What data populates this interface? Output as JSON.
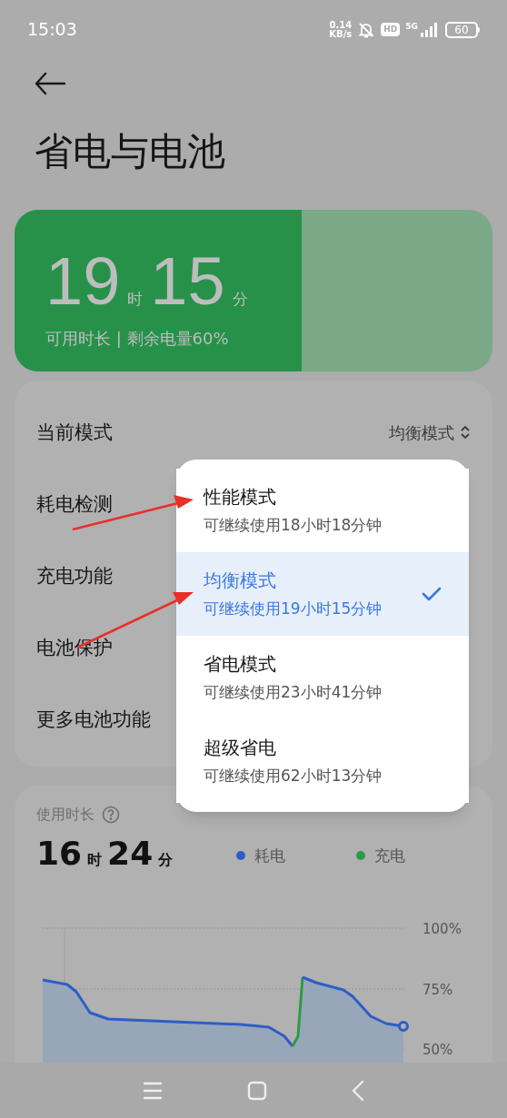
{
  "status_bar": {
    "time": "15:03",
    "speed_value": "0.14",
    "speed_unit": "KB/s",
    "hd": "HD",
    "network": "5G",
    "battery": "60"
  },
  "title": "省电与电池",
  "battery_card": {
    "hours": "19",
    "hour_unit": "时",
    "minutes": "15",
    "minute_unit": "分",
    "caption": "可用时长 | 剩余电量60%",
    "level": 0.6
  },
  "settings": [
    {
      "label": "当前模式",
      "value": "均衡模式"
    },
    {
      "label": "耗电检测"
    },
    {
      "label": "充电功能"
    },
    {
      "label": "电池保护"
    },
    {
      "label": "更多电池功能"
    }
  ],
  "mode_menu": [
    {
      "name": "性能模式",
      "estimate": "可继续使用18小时18分钟",
      "selected": false
    },
    {
      "name": "均衡模式",
      "estimate": "可继续使用19小时15分钟",
      "selected": true
    },
    {
      "name": "省电模式",
      "estimate": "可继续使用23小时41分钟",
      "selected": false
    },
    {
      "name": "超级省电",
      "estimate": "可继续使用62小时13分钟",
      "selected": false
    }
  ],
  "usage": {
    "title": "使用时长",
    "hours": "16",
    "hour_unit": "时",
    "minutes": "24",
    "minute_unit": "分",
    "legend": [
      {
        "label": "耗电",
        "color": "#2c5fc6"
      },
      {
        "label": "充电",
        "color": "#2e9a48"
      }
    ],
    "axis_labels": [
      "100%",
      "75%",
      "50%"
    ]
  }
}
